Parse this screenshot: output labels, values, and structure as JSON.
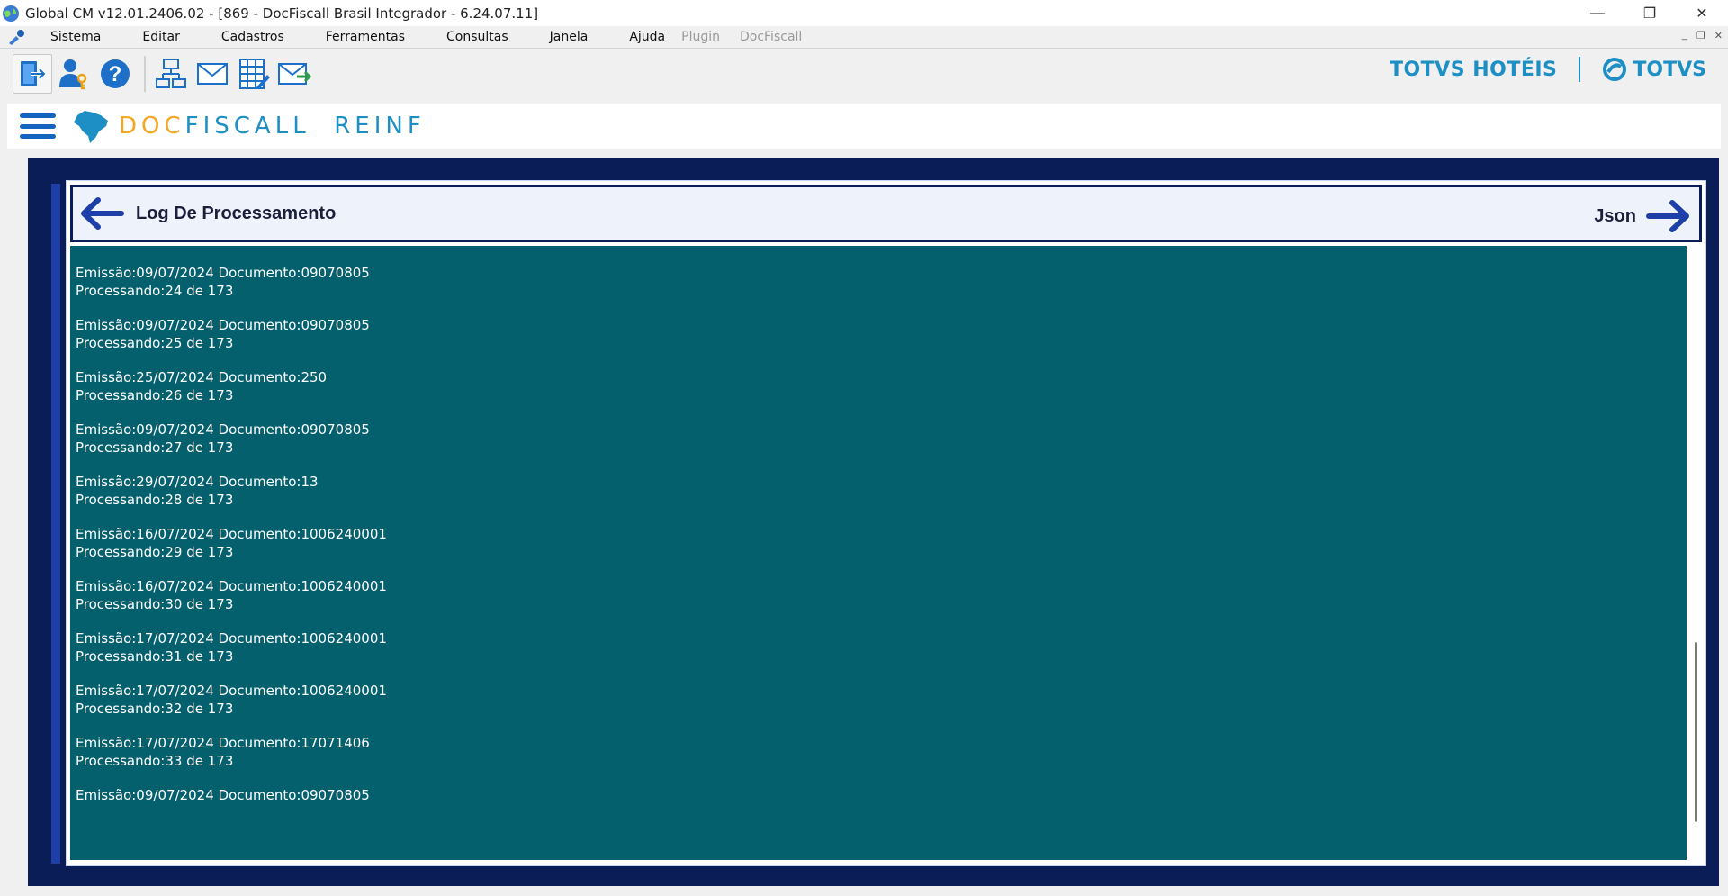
{
  "window": {
    "title": "Global CM v12.01.2406.02 - [869 - DocFiscall Brasil Integrador - 6.24.07.11]",
    "controls": {
      "minimize": "—",
      "restore": "❐",
      "close": "✕"
    }
  },
  "menu": {
    "items": [
      {
        "label": "Sistema"
      },
      {
        "label": "Editar"
      },
      {
        "label": "Cadastros"
      },
      {
        "label": "Ferramentas"
      },
      {
        "label": "Consultas"
      },
      {
        "label": "Janela"
      },
      {
        "label": "Ajuda"
      }
    ],
    "disabled_items": [
      {
        "label": "Plugin"
      },
      {
        "label": "DocFiscall"
      }
    ],
    "mdi_controls": {
      "minimize": "_",
      "restore": "❐",
      "close": "✕"
    }
  },
  "toolbar": {
    "icons": [
      "exit-icon",
      "user-key-icon",
      "help-icon",
      "network-icon",
      "mail-icon",
      "calculator-icon",
      "send-mail-icon"
    ]
  },
  "branding": {
    "hoteis": "TOTVS HOTÉIS",
    "totvs": "TOTVS",
    "color": "#1e8fc5"
  },
  "app_header": {
    "title_accent": "DOC",
    "title_rest": "FISCALL  REINF",
    "accent_color": "#f5a623"
  },
  "panel": {
    "title": "Log De Processamento",
    "next_label": "Json"
  },
  "log": {
    "entries": [
      {
        "line1": "Emissão:09/07/2024 Documento:09070805",
        "line2": "Processando:24 de 173"
      },
      {
        "line1": "Emissão:09/07/2024 Documento:09070805",
        "line2": "Processando:25 de 173"
      },
      {
        "line1": "Emissão:25/07/2024 Documento:250",
        "line2": "Processando:26 de 173"
      },
      {
        "line1": "Emissão:09/07/2024 Documento:09070805",
        "line2": "Processando:27 de 173"
      },
      {
        "line1": "Emissão:29/07/2024 Documento:13",
        "line2": "Processando:28 de 173"
      },
      {
        "line1": "Emissão:16/07/2024 Documento:1006240001",
        "line2": "Processando:29 de 173"
      },
      {
        "line1": "Emissão:16/07/2024 Documento:1006240001",
        "line2": "Processando:30 de 173"
      },
      {
        "line1": "Emissão:17/07/2024 Documento:1006240001",
        "line2": "Processando:31 de 173"
      },
      {
        "line1": "Emissão:17/07/2024 Documento:1006240001",
        "line2": "Processando:32 de 173"
      },
      {
        "line1": "Emissão:17/07/2024 Documento:17071406",
        "line2": "Processando:33 de 173"
      },
      {
        "line1": "Emissão:09/07/2024 Documento:09070805",
        "line2": ""
      }
    ]
  }
}
